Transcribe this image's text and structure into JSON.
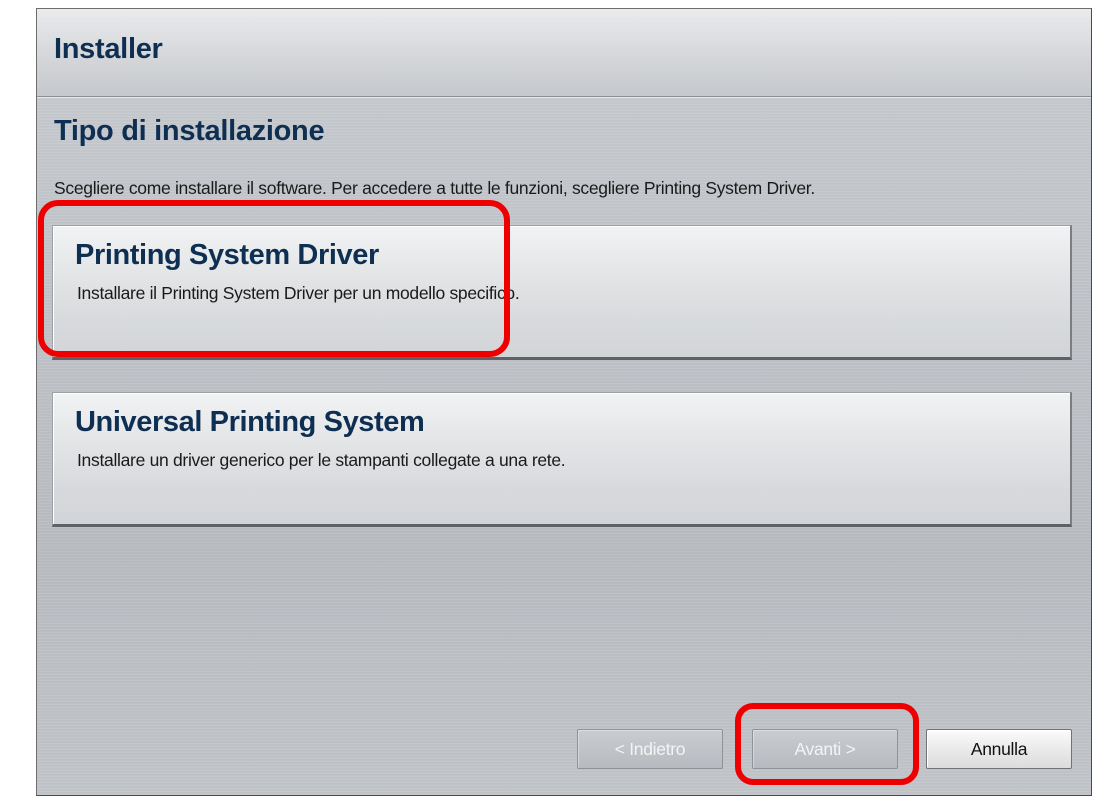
{
  "window": {
    "title": "Installer"
  },
  "page": {
    "heading": "Tipo di installazione",
    "description": "Scegliere come installare il software. Per accedere a tutte le funzioni, scegliere Printing System Driver."
  },
  "options": [
    {
      "title": "Printing System Driver",
      "description": "Installare il Printing System Driver per un modello specifico."
    },
    {
      "title": "Universal Printing System",
      "description": "Installare un driver generico per le stampanti collegate a una rete."
    }
  ],
  "footer": {
    "back_label": "< Indietro",
    "next_label": "Avanti >",
    "cancel_label": "Annulla",
    "back_enabled": false,
    "next_enabled": false,
    "cancel_enabled": true
  },
  "colors": {
    "heading_text": "#0f2f52",
    "highlight": "#ee0000",
    "window_background": "#bfc3c8"
  },
  "annotations": {
    "highlighted_items": [
      "Printing System Driver",
      "Avanti >"
    ]
  }
}
